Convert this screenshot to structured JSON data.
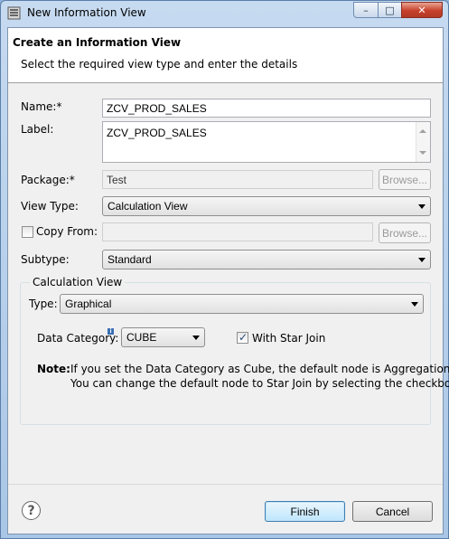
{
  "window": {
    "title": "New Information View",
    "controls": {
      "minimize": "–",
      "maximize": "□",
      "close": "✕"
    }
  },
  "header": {
    "title": "Create an Information View",
    "message": "Select the required view type and enter the details"
  },
  "form": {
    "name": {
      "label": "Name:*",
      "value": "ZCV_PROD_SALES"
    },
    "label_field": {
      "label": "Label:",
      "value": "ZCV_PROD_SALES"
    },
    "package": {
      "label": "Package:*",
      "value": "Test",
      "browse": "Browse..."
    },
    "view_type": {
      "label": "View Type:",
      "value": "Calculation View"
    },
    "copy_from": {
      "label": "Copy From:",
      "checked": false,
      "value": "",
      "browse": "Browse..."
    },
    "subtype": {
      "label": "Subtype:",
      "value": "Standard"
    }
  },
  "calc_group": {
    "title": "Calculation View",
    "type": {
      "label": "Type:",
      "value": "Graphical"
    },
    "data_category": {
      "label": "Data Category:",
      "value": "CUBE"
    },
    "star_join": {
      "label": "With Star Join",
      "checked": true,
      "mark": "✓"
    },
    "note": {
      "prefix": "Note:",
      "line1": "If you set the Data Category as Cube, the default node is Aggregation.",
      "line2": "You can change the default node to Star Join by selecting the checkbox."
    }
  },
  "footer": {
    "help": "?",
    "finish": "Finish",
    "cancel": "Cancel"
  },
  "colors": {
    "title_bar": "#a9c6e6",
    "close_button": "#c7412c",
    "default_button": "#bee6fd"
  }
}
